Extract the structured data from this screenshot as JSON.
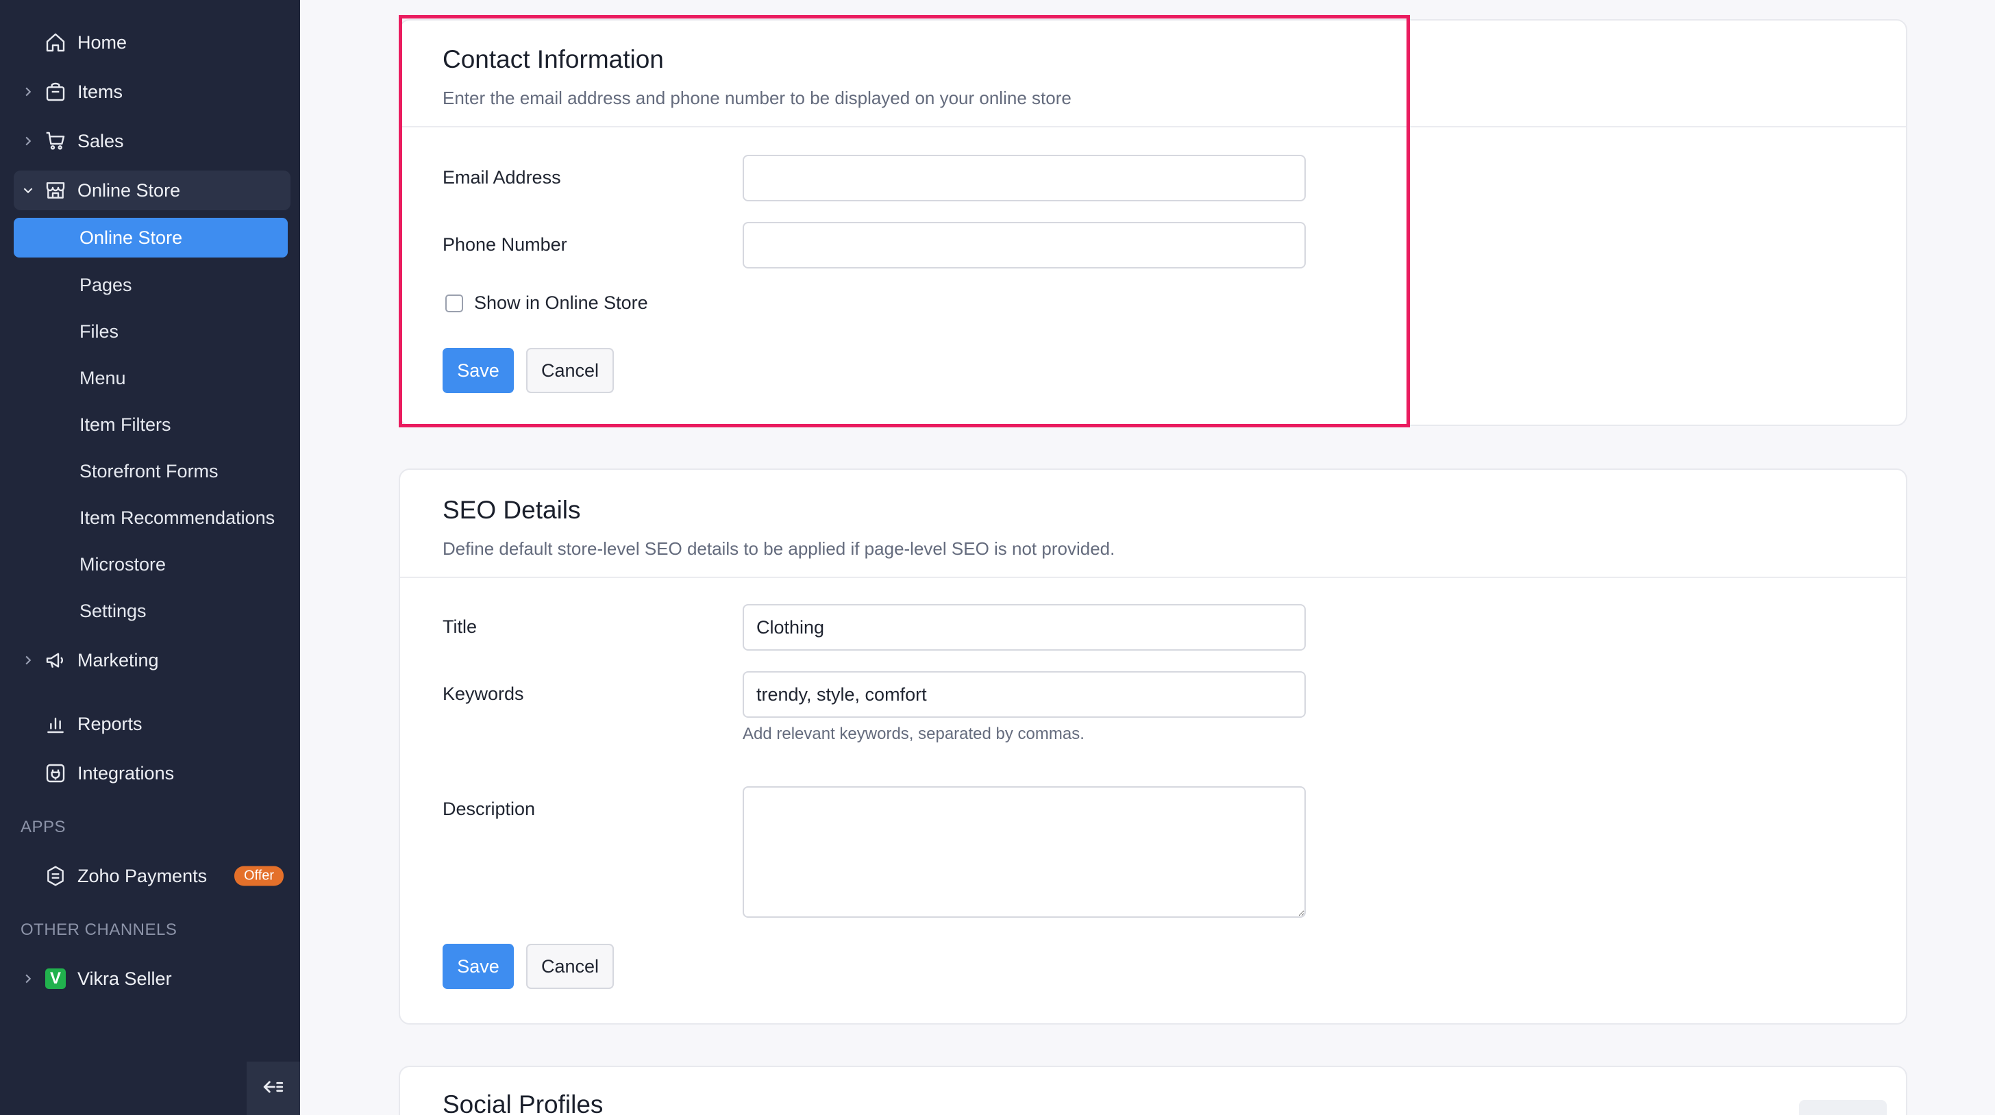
{
  "sidebar": {
    "home": "Home",
    "items": "Items",
    "sales": "Sales",
    "online_store_group": "Online Store",
    "sub_items": [
      "Online Store",
      "Pages",
      "Files",
      "Menu",
      "Item Filters",
      "Storefront Forms",
      "Item Recommendations",
      "Microstore",
      "Settings"
    ],
    "marketing": "Marketing",
    "reports": "Reports",
    "integrations": "Integrations",
    "apps_label": "APPS",
    "zoho_payments": "Zoho Payments",
    "offer_badge": "Offer",
    "other_channels_label": "OTHER CHANNELS",
    "vikra_seller": "Vikra Seller",
    "vikra_logo_letter": "V"
  },
  "contact": {
    "title": "Contact Information",
    "subtitle": "Enter the email address and phone number to be displayed on your online store",
    "email_label": "Email Address",
    "email_value": "",
    "phone_label": "Phone Number",
    "phone_value": "",
    "show_label": "Show in Online Store",
    "show_checked": false,
    "save": "Save",
    "cancel": "Cancel"
  },
  "seo": {
    "title": "SEO Details",
    "subtitle": "Define default store-level SEO details to be applied if page-level SEO is not provided.",
    "title_label": "Title",
    "title_value": "Clothing",
    "keywords_label": "Keywords",
    "keywords_value": "trendy, style, comfort",
    "keywords_hint": "Add relevant keywords, separated by commas.",
    "description_label": "Description",
    "description_value": "",
    "save": "Save",
    "cancel": "Cancel"
  },
  "social": {
    "title": "Social Profiles"
  },
  "colors": {
    "sidebar_bg": "#20263a",
    "accent": "#3e8df0",
    "highlight": "#ea1c5f",
    "offer": "#e4702a",
    "vikra_green": "#21b14d"
  }
}
